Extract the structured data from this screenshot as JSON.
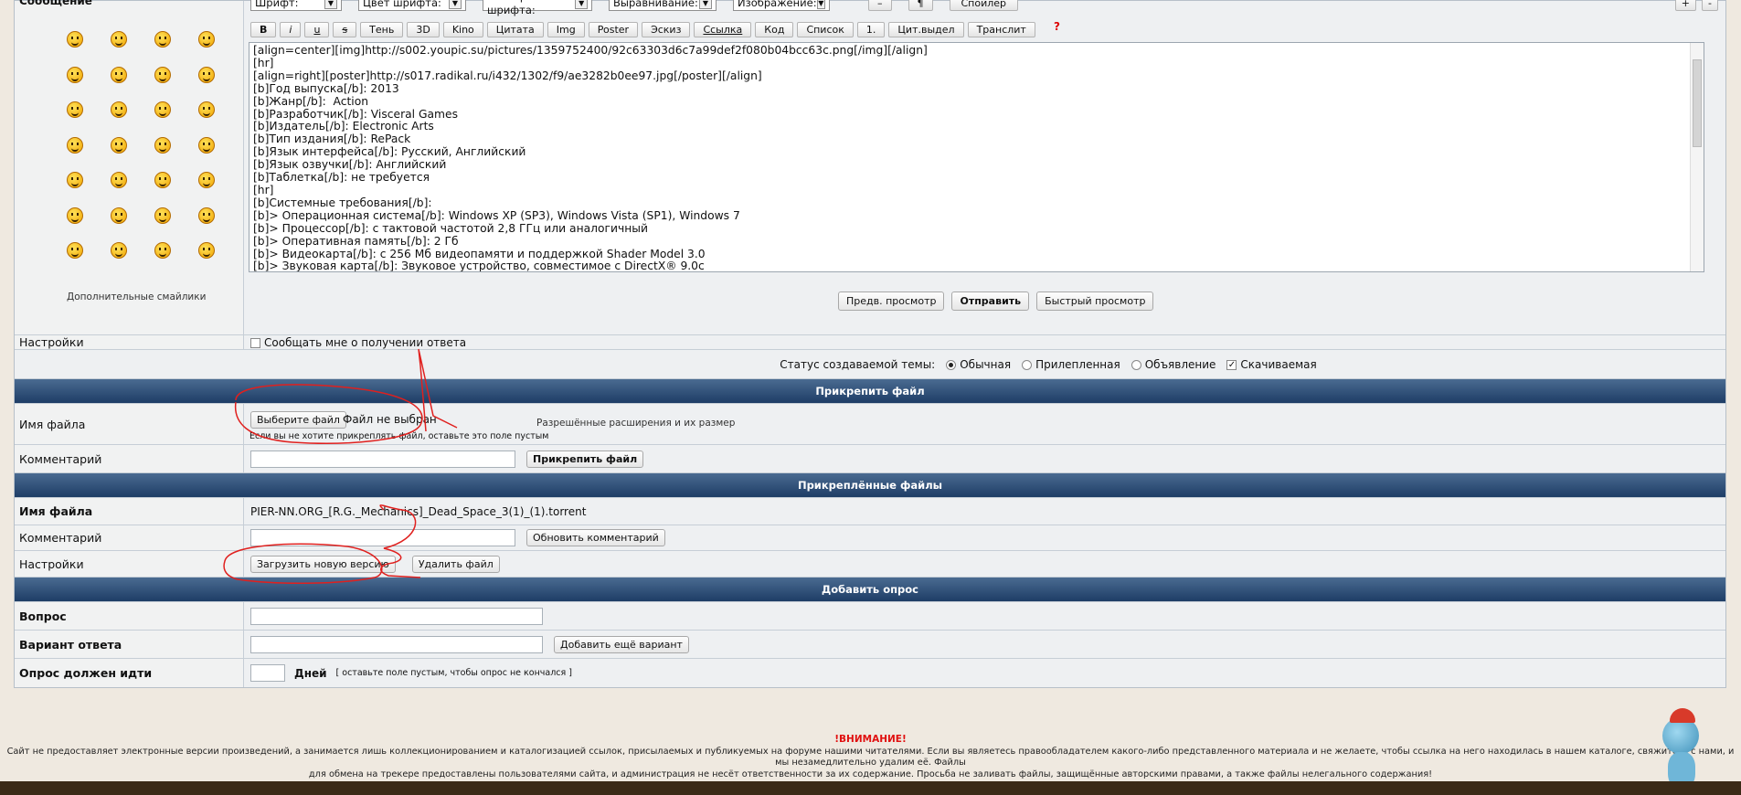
{
  "editor": {
    "message_label": "Сообщение",
    "dropdowns": [
      "Шрифт:",
      "Цвет шрифта:",
      "Размер шрифта:",
      "Выравнивание:",
      "Изображение:"
    ],
    "top_right_buttons": [
      "–",
      "¶",
      "Спойлер",
      "+",
      "-"
    ],
    "toolbar": [
      "B",
      "i",
      "u",
      "s",
      "Тень",
      "3D",
      "Kino",
      "Цитата",
      "Img",
      "Poster",
      "Эскиз",
      "Ссылка",
      "Код",
      "Список",
      "1.",
      "Цит.выдел",
      "Транслит"
    ],
    "help": "?",
    "text_lines": [
      "[align=center][img]http://s002.youpic.su/pictures/1359752400/92c63303d6c7a99def2f080b04bcc63c.png[/img][/align]",
      "[hr]",
      "[align=right][poster]http://s017.radikal.ru/i432/1302/f9/ae3282b0ee97.jpg[/poster][/align]",
      "[b]Год выпуска[/b]: 2013",
      "[b]Жанр[/b]:  Action",
      "[b]Разработчик[/b]: Visceral Games",
      "[b]Издатель[/b]: Electronic Arts",
      "[b]Тип издания[/b]: RePack",
      "[b]Язык интерфейса[/b]: Русский, Английский",
      "[b]Язык озвучки[/b]: Английский",
      "[b]Таблетка[/b]: не требуется",
      "[hr]",
      "[b]Системные требования[/b]:",
      "[b]> Операционная система[/b]: Windows XP (SP3), Windows Vista (SP1), Windows 7",
      "[b]> Процессор[/b]: с тактовой частотой 2,8 ГГц или аналогичный",
      "[b]> Оперативная память[/b]: 2 Гб",
      "[b]> Видеокарта[/b]: с 256 Мб видеопамяти и поддержкой Shader Model 3.0",
      "[b]> Звуковая карта[/b]: Звуковое устройство, совместимое с DirectX® 9.0c"
    ],
    "more_smilies": "Дополнительные смайлики",
    "preview": "Предв. просмотр",
    "submit": "Отправить",
    "quick_preview": "Быстрый просмотр"
  },
  "settings": {
    "label": "Настройки",
    "notify": "Сообщать мне о получении ответа"
  },
  "status": {
    "label": "Статус создаваемой темы:",
    "options": [
      "Обычная",
      "Прилепленная",
      "Объявление"
    ],
    "selected": "Обычная",
    "downloadable": "Скачиваемая"
  },
  "attach": {
    "header": "Прикрепить файл",
    "filename_label": "Имя файла",
    "choose_button": "Выберите файл",
    "no_file": "Файл не выбран",
    "hint": "Если вы не хотите прикреплять файл, оставьте это поле пустым",
    "allowed": "Разрешённые расширения и их размер",
    "comment_label": "Комментарий",
    "attach_button": "Прикрепить файл"
  },
  "attached": {
    "header": "Прикреплённые файлы",
    "filename_label": "Имя файла",
    "filename": "PIER-NN.ORG_[R.G._Mechanics]_Dead_Space_3(1)_(1).torrent",
    "comment_label": "Комментарий",
    "update_button": "Обновить комментарий",
    "settings_label": "Настройки",
    "upload_new": "Загрузить новую версию",
    "delete": "Удалить файл"
  },
  "poll": {
    "header": "Добавить опрос",
    "question": "Вопрос",
    "answer": "Вариант ответа",
    "add_variant": "Добавить ещё вариант",
    "duration": "Опрос должен идти",
    "days": "Дней",
    "duration_hint": "[ оставьте поле пустым, чтобы опрос не кончался ]"
  },
  "footer": {
    "warning": "!ВНИМАНИЕ!",
    "line1": "Сайт не предоставляет электронные версии произведений, а занимается лишь коллекционированием и каталогизацией ссылок, присылаемых и публикуемых на форуме нашими читателями. Если вы являетесь правообладателем какого-либо представленного материала и не желаете, чтобы ссылка на него находилась в нашем каталоге, свяжитесь с нами, и мы незамедлительно удалим её. Файлы",
    "line2": "для обмена на трекере предоставлены пользователями сайта, и администрация не несёт ответственности за их содержание. Просьба не заливать файлы, защищённые авторскими правами, а также файлы нелегального содержания!"
  }
}
